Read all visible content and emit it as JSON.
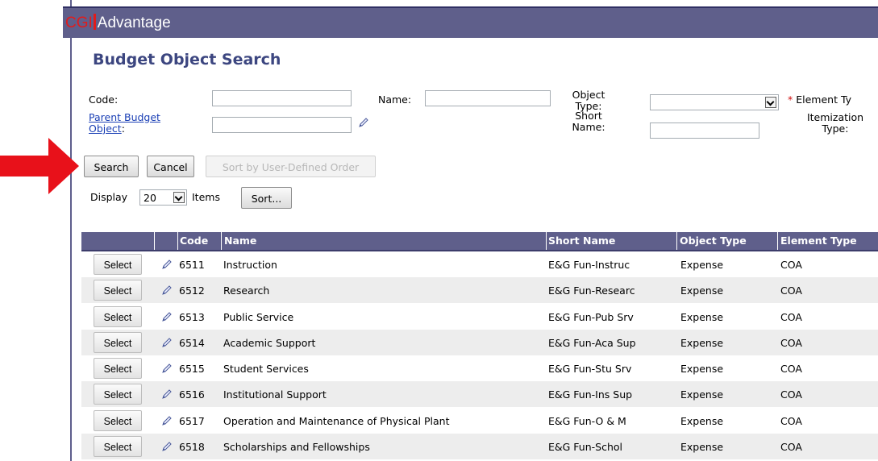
{
  "app": {
    "brand_prefix": "CGI",
    "brand_name": "Advantage"
  },
  "page": {
    "title": "Budget Object Search"
  },
  "form": {
    "code_label": "Code:",
    "code_value": "",
    "name_label": "Name:",
    "name_value": "",
    "object_type_label_1": "Object",
    "object_type_label_2": "Type:",
    "object_type_value": "",
    "element_type_star": "*",
    "element_type_label": "Element Ty",
    "parent_budget_object_label_1": "Parent Budget",
    "parent_budget_object_label_2": "Object",
    "parent_budget_object_colon": ":",
    "parent_budget_object_value": "",
    "short_name_label_1": "Short",
    "short_name_label_2": "Name:",
    "short_name_value": "",
    "itemization_type_label_1": "Itemization",
    "itemization_type_label_2": "Type:"
  },
  "actions": {
    "search_label": "Search",
    "cancel_label": "Cancel",
    "sort_user_defined_label": "Sort by User-Defined Order",
    "display_label": "Display",
    "display_count": "20",
    "items_label": "Items",
    "sort_label": "Sort..."
  },
  "colors": {
    "header_bar": "#5f5f8b",
    "title_text": "#3c4680",
    "link": "#1a3fb5",
    "arrow": "#e8111a",
    "row_alt": "#ededed"
  },
  "icons": {
    "pencil": "pencil-icon",
    "dropdown": "chevron-down-icon",
    "arrow": "red-pointer-arrow"
  },
  "grid": {
    "columns": [
      "Code",
      "Name",
      "Short Name",
      "Object Type",
      "Element Type"
    ],
    "select_label": "Select",
    "rows": [
      {
        "code": "6511",
        "name": "Instruction",
        "short_name": "E&G Fun-Instruc",
        "object_type": "Expense",
        "element_type": "COA"
      },
      {
        "code": "6512",
        "name": "Research",
        "short_name": "E&G Fun-Researc",
        "object_type": "Expense",
        "element_type": "COA"
      },
      {
        "code": "6513",
        "name": "Public Service",
        "short_name": "E&G Fun-Pub Srv",
        "object_type": "Expense",
        "element_type": "COA"
      },
      {
        "code": "6514",
        "name": "Academic Support",
        "short_name": "E&G Fun-Aca Sup",
        "object_type": "Expense",
        "element_type": "COA"
      },
      {
        "code": "6515",
        "name": "Student Services",
        "short_name": "E&G Fun-Stu Srv",
        "object_type": "Expense",
        "element_type": "COA"
      },
      {
        "code": "6516",
        "name": "Institutional Support",
        "short_name": "E&G Fun-Ins Sup",
        "object_type": "Expense",
        "element_type": "COA"
      },
      {
        "code": "6517",
        "name": "Operation and Maintenance of Physical Plant",
        "short_name": "E&G Fun-O & M",
        "object_type": "Expense",
        "element_type": "COA"
      },
      {
        "code": "6518",
        "name": "Scholarships and Fellowships",
        "short_name": "E&G Fun-Schol",
        "object_type": "Expense",
        "element_type": "COA"
      }
    ]
  }
}
